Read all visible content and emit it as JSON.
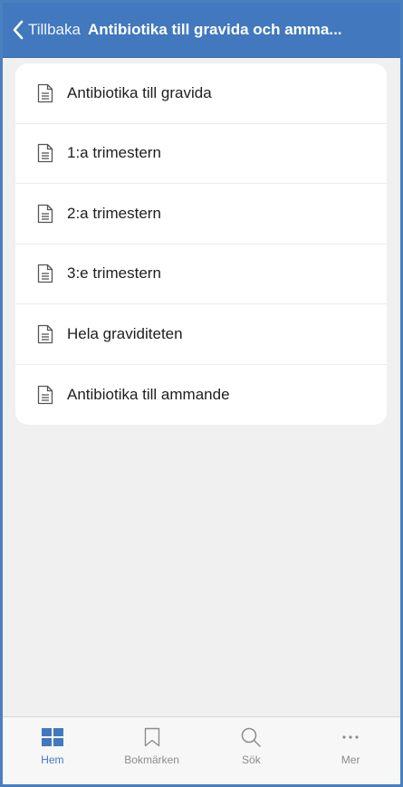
{
  "header": {
    "back_label": "Tillbaka",
    "title": "Antibiotika till gravida och amma..."
  },
  "list": {
    "items": [
      {
        "label": "Antibiotika till gravida",
        "icon": "document-icon"
      },
      {
        "label": "1:a trimestern",
        "icon": "document-icon"
      },
      {
        "label": "2:a trimestern",
        "icon": "document-icon"
      },
      {
        "label": "3:e trimestern",
        "icon": "document-icon"
      },
      {
        "label": "Hela graviditeten",
        "icon": "document-icon"
      },
      {
        "label": "Antibiotika till ammande",
        "icon": "document-icon"
      }
    ]
  },
  "tabbar": {
    "tabs": [
      {
        "label": "Hem",
        "icon": "grid-icon",
        "active": true
      },
      {
        "label": "Bokmärken",
        "icon": "bookmark-icon",
        "active": false
      },
      {
        "label": "Sök",
        "icon": "search-icon",
        "active": false
      },
      {
        "label": "Mer",
        "icon": "more-icon",
        "active": false
      }
    ]
  },
  "colors": {
    "header_bg": "#4178be",
    "accent": "#4178be",
    "background": "#f0f0f0",
    "inactive": "#8c8c8c"
  }
}
